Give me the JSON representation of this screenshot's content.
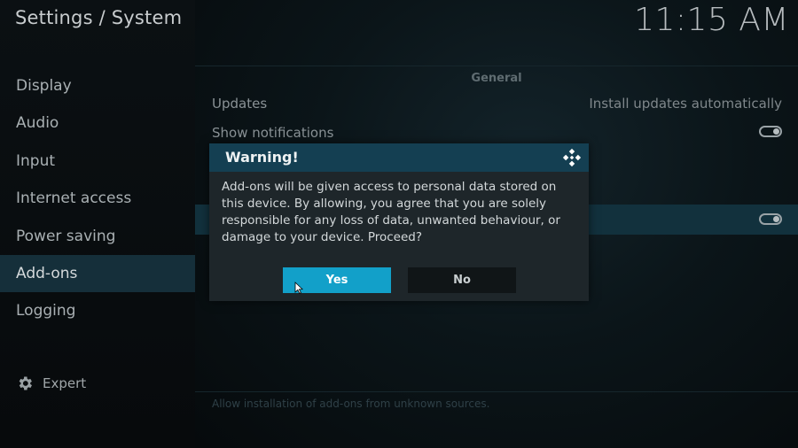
{
  "header": {
    "title": "Settings / System",
    "clock": "11:15 AM"
  },
  "sidebar": {
    "items": [
      {
        "label": "Display"
      },
      {
        "label": "Audio"
      },
      {
        "label": "Input"
      },
      {
        "label": "Internet access"
      },
      {
        "label": "Power saving"
      },
      {
        "label": "Add-ons"
      },
      {
        "label": "Logging"
      }
    ],
    "active": "Add-ons",
    "level_label": "Expert",
    "level_icon": "gear-icon"
  },
  "panel": {
    "section": "General",
    "rows": [
      {
        "label": "Updates",
        "value": "Install updates automatically"
      },
      {
        "label": "Show notifications",
        "toggle": "on"
      },
      {
        "label": "",
        "toggle": "on",
        "highlighted": true
      }
    ],
    "hint": "Allow installation of add-ons from unknown sources."
  },
  "dialog": {
    "title": "Warning!",
    "icon": "kodi-logo-icon",
    "message": "Add-ons will be given access to personal data stored on this device. By allowing, you agree that you are solely responsible for any loss of data, unwanted behaviour, or damage to your device. Proceed?",
    "yes_label": "Yes",
    "no_label": "No",
    "focused": "Yes"
  },
  "colors": {
    "accent": "#12a0c9",
    "active_nav": "#152f3a",
    "dialog_header": "#143f52"
  }
}
